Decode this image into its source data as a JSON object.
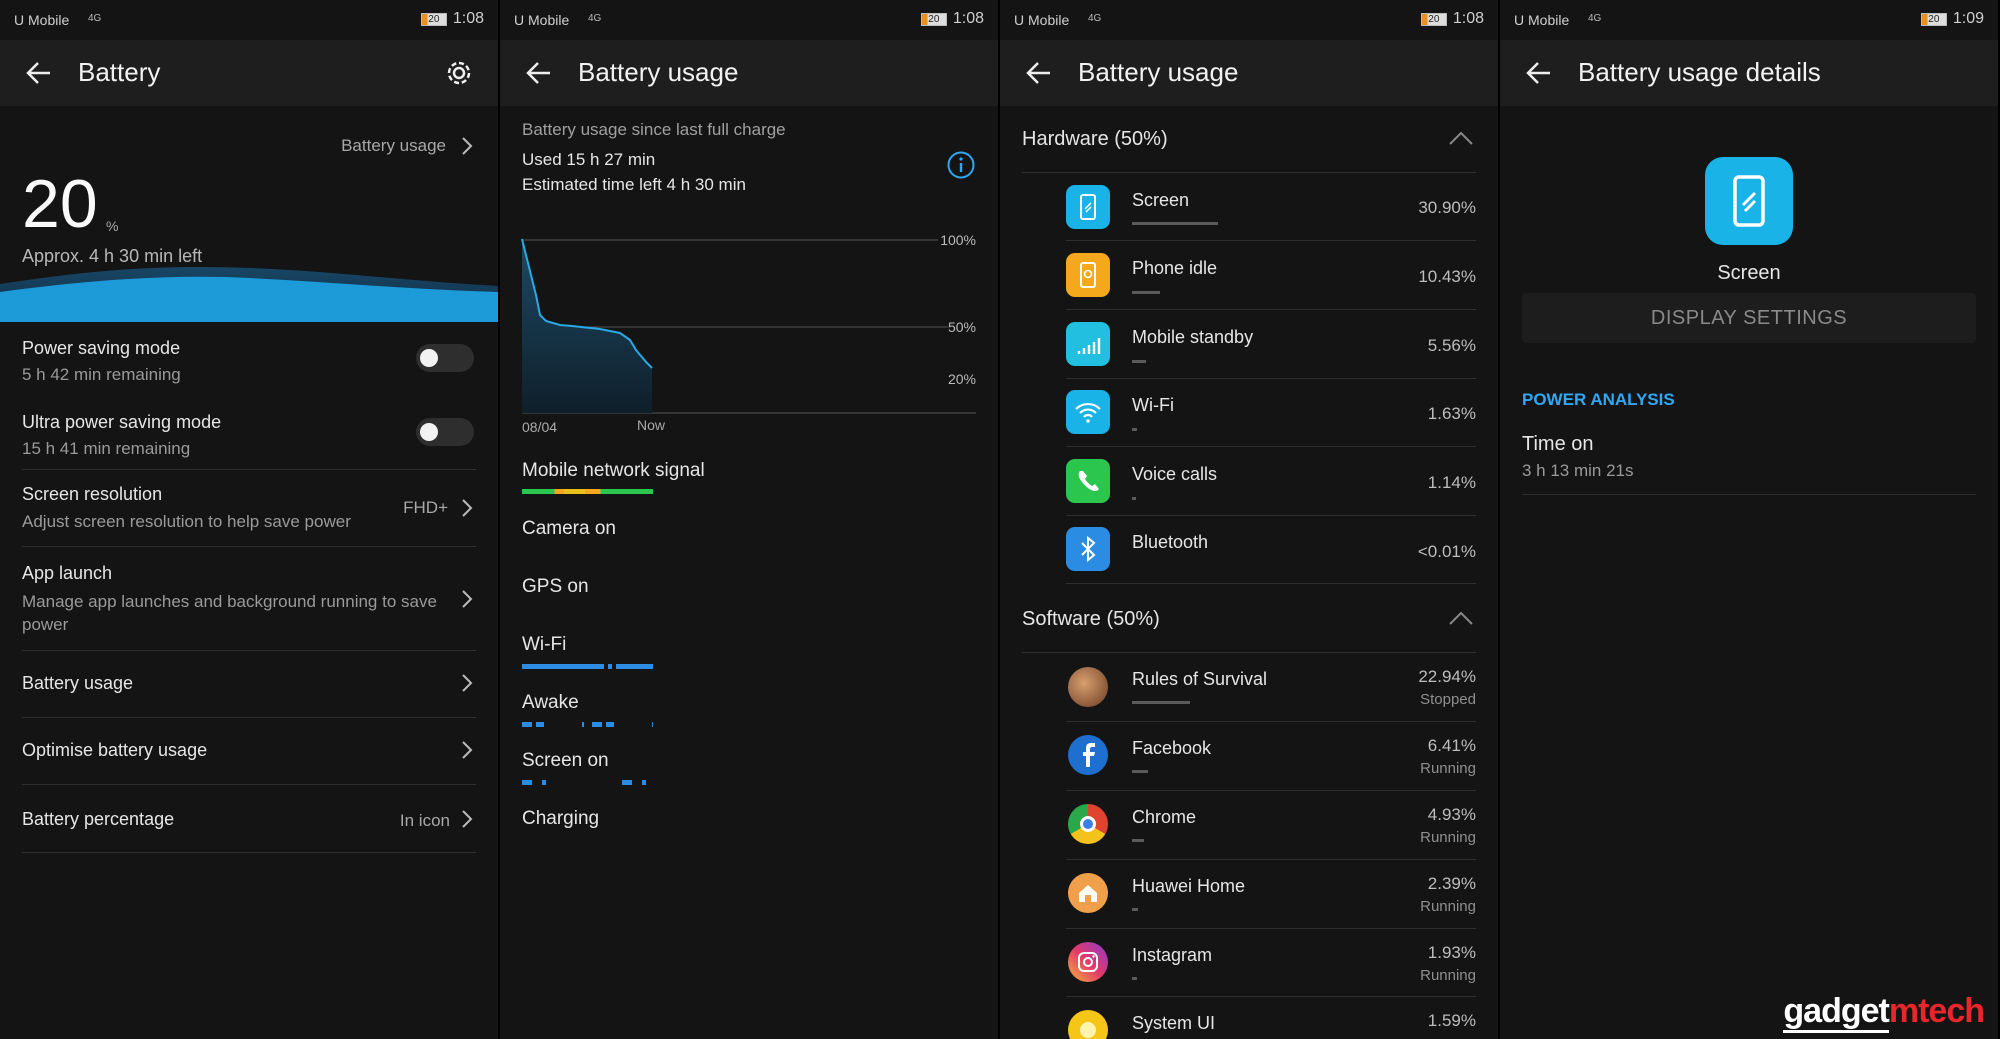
{
  "colors": {
    "accent": "#2fa8f5",
    "screen_icon": "#19b3e8",
    "idle_icon": "#f5a81c",
    "green": "#2bc64e",
    "bluetooth": "#2a8de3"
  },
  "status": {
    "carrier": "U Mobile",
    "net": "4G",
    "battery": "20",
    "time_p1": "1:08",
    "time_p2": "1:08",
    "time_p3": "1:08",
    "time_p4": "1:09"
  },
  "p1": {
    "title": "Battery",
    "battery_usage_link": "Battery usage",
    "level": "20",
    "level_unit": "%",
    "time_left": "Approx. 4 h 30 min left",
    "items": [
      {
        "label": "Power saving mode",
        "sub": "5 h 42 min remaining"
      },
      {
        "label": "Ultra power saving mode",
        "sub": "15 h 41 min remaining"
      },
      {
        "label": "Screen resolution",
        "sub": "Adjust screen resolution to help save power",
        "value": "FHD+"
      },
      {
        "label": "App launch",
        "sub": "Manage app launches and background running to save power"
      },
      {
        "label": "Battery usage"
      },
      {
        "label": "Optimise battery usage"
      },
      {
        "label": "Battery percentage",
        "value": "In icon"
      }
    ]
  },
  "p2": {
    "title": "Battery usage",
    "since": "Battery usage since last full charge",
    "used": "Used 15 h 27 min",
    "estimated": "Estimated time left 4 h 30 min",
    "chart_data": {
      "type": "line",
      "title": "",
      "x_labels": [
        "08/04",
        "Now"
      ],
      "y_ticks": [
        "100%",
        "50%",
        "20%"
      ],
      "ylim": [
        0,
        100
      ]
    },
    "tracks": [
      "Mobile network signal",
      "Camera on",
      "GPS on",
      "Wi-Fi",
      "Awake",
      "Screen on",
      "Charging"
    ]
  },
  "p3": {
    "title": "Battery usage",
    "hardware_header": "Hardware (50%)",
    "software_header": "Software (50%)",
    "hardware": [
      {
        "name": "Screen",
        "pct": "30.90%",
        "icon": "phone-screen-icon"
      },
      {
        "name": "Phone idle",
        "pct": "10.43%",
        "icon": "phone-idle-icon"
      },
      {
        "name": "Mobile standby",
        "pct": "5.56%",
        "icon": "signal-icon"
      },
      {
        "name": "Wi-Fi",
        "pct": "1.63%",
        "icon": "wifi-icon"
      },
      {
        "name": "Voice calls",
        "pct": "1.14%",
        "icon": "phone-call-icon"
      },
      {
        "name": "Bluetooth",
        "pct": "<0.01%",
        "icon": "bluetooth-icon"
      }
    ],
    "software": [
      {
        "name": "Rules of Survival",
        "pct": "22.94%",
        "state": "Stopped"
      },
      {
        "name": "Facebook",
        "pct": "6.41%",
        "state": "Running"
      },
      {
        "name": "Chrome",
        "pct": "4.93%",
        "state": "Running"
      },
      {
        "name": "Huawei Home",
        "pct": "2.39%",
        "state": "Running"
      },
      {
        "name": "Instagram",
        "pct": "1.93%",
        "state": "Running"
      },
      {
        "name": "System UI",
        "pct": "1.59%",
        "state": ""
      }
    ]
  },
  "p4": {
    "title": "Battery usage details",
    "app_name": "Screen",
    "display_settings": "DISPLAY SETTINGS",
    "power_analysis": "POWER ANALYSIS",
    "time_on_label": "Time on",
    "time_on_value": "3 h 13 min 21s"
  },
  "watermark": {
    "part1": "gadget",
    "part2": "mtech"
  }
}
